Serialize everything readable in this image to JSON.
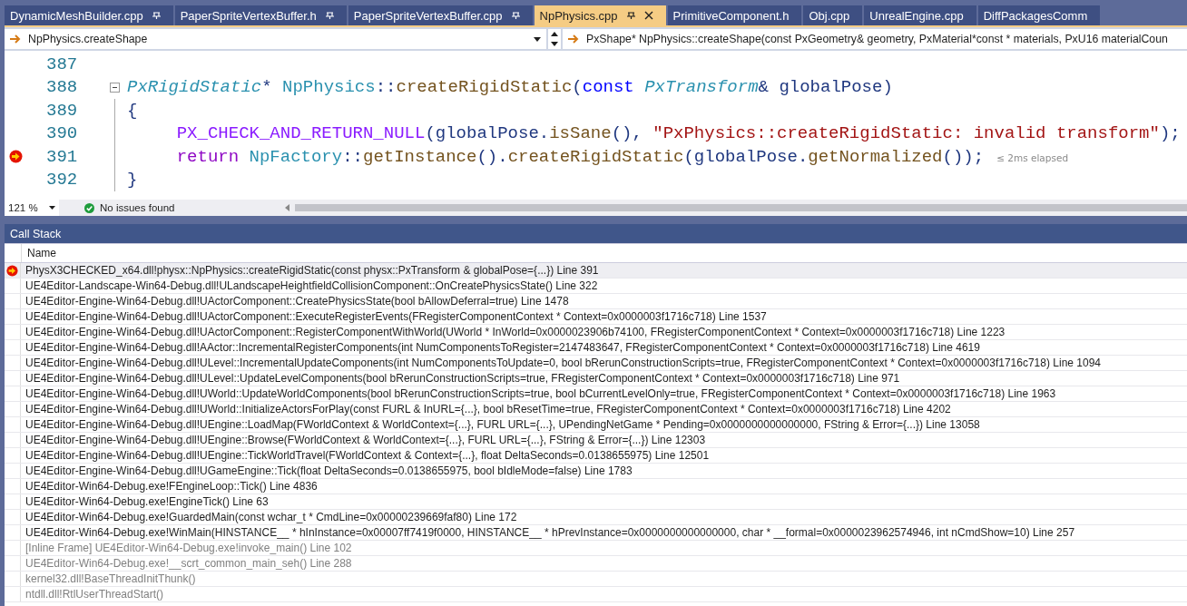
{
  "tabs": [
    {
      "label": "DynamicMeshBuilder.cpp",
      "selected": false,
      "pinned": true
    },
    {
      "label": "PaperSpriteVertexBuffer.h",
      "selected": false,
      "pinned": true
    },
    {
      "label": "PaperSpriteVertexBuffer.cpp",
      "selected": false,
      "pinned": true
    },
    {
      "label": "NpPhysics.cpp",
      "selected": true,
      "pinned": true
    },
    {
      "label": "PrimitiveComponent.h",
      "selected": false,
      "pinned": false
    },
    {
      "label": "Obj.cpp",
      "selected": false,
      "pinned": false
    },
    {
      "label": "UnrealEngine.cpp",
      "selected": false,
      "pinned": false
    },
    {
      "label": "DiffPackagesComm",
      "selected": false,
      "pinned": false
    }
  ],
  "navigation": {
    "scope": "NpPhysics.createShape",
    "member": "PxShape* NpPhysics::createShape(const PxGeometry& geometry, PxMaterial*const * materials, PxU16 materialCoun"
  },
  "editor": {
    "lines": [
      {
        "number": "387",
        "foldable": false,
        "breakpoint": false
      },
      {
        "number": "388",
        "foldable": true,
        "breakpoint": false,
        "indented": false,
        "tokens": [
          {
            "kind": "type",
            "text": "PxRigidStatic"
          },
          {
            "kind": "plain",
            "text": "* "
          },
          {
            "kind": "class",
            "text": "NpPhysics"
          },
          {
            "kind": "plain",
            "text": "::"
          },
          {
            "kind": "func",
            "text": "createRigidStatic"
          },
          {
            "kind": "plain",
            "text": "("
          },
          {
            "kind": "keyword",
            "text": "const "
          },
          {
            "kind": "type",
            "text": "PxTransform"
          },
          {
            "kind": "plain",
            "text": "& globalPose)"
          }
        ]
      },
      {
        "number": "389",
        "foldable": false,
        "breakpoint": false,
        "indented": false,
        "tokens": [
          {
            "kind": "plain",
            "text": "{"
          }
        ]
      },
      {
        "number": "390",
        "foldable": false,
        "breakpoint": false,
        "indented": true,
        "tokens": [
          {
            "kind": "macro",
            "text": "PX_CHECK_AND_RETURN_NULL"
          },
          {
            "kind": "plain",
            "text": "(globalPose."
          },
          {
            "kind": "func",
            "text": "isSane"
          },
          {
            "kind": "plain",
            "text": "(), "
          },
          {
            "kind": "string",
            "text": "\"PxPhysics::createRigidStatic: invalid transform\""
          },
          {
            "kind": "plain",
            "text": ");"
          }
        ]
      },
      {
        "number": "391",
        "foldable": false,
        "breakpoint": true,
        "indented": true,
        "tokens": [
          {
            "kind": "control",
            "text": "return "
          },
          {
            "kind": "class",
            "text": "NpFactory"
          },
          {
            "kind": "plain",
            "text": "::"
          },
          {
            "kind": "func",
            "text": "getInstance"
          },
          {
            "kind": "plain",
            "text": "()."
          },
          {
            "kind": "func",
            "text": "createRigidStatic"
          },
          {
            "kind": "plain",
            "text": "(globalPose."
          },
          {
            "kind": "func",
            "text": "getNormalized"
          },
          {
            "kind": "plain",
            "text": "());"
          },
          {
            "kind": "hint",
            "text": "≤ 2ms elapsed"
          }
        ]
      },
      {
        "number": "392",
        "foldable": false,
        "breakpoint": false,
        "indented": false,
        "tokens": [
          {
            "kind": "plain",
            "text": "}"
          }
        ]
      }
    ]
  },
  "status": {
    "zoom": "121 %",
    "issues": "No issues found"
  },
  "call_stack": {
    "title": "Call Stack",
    "column": "Name",
    "frames": [
      {
        "kind": "current",
        "text": "PhysX3CHECKED_x64.dll!physx::NpPhysics::createRigidStatic(const physx::PxTransform & globalPose={...}) Line 391"
      },
      {
        "kind": "normal",
        "text": "UE4Editor-Landscape-Win64-Debug.dll!ULandscapeHeightfieldCollisionComponent::OnCreatePhysicsState() Line 322"
      },
      {
        "kind": "normal",
        "text": "UE4Editor-Engine-Win64-Debug.dll!UActorComponent::CreatePhysicsState(bool bAllowDeferral=true) Line 1478"
      },
      {
        "kind": "normal",
        "text": "UE4Editor-Engine-Win64-Debug.dll!UActorComponent::ExecuteRegisterEvents(FRegisterComponentContext * Context=0x0000003f1716c718) Line 1537"
      },
      {
        "kind": "normal",
        "text": "UE4Editor-Engine-Win64-Debug.dll!UActorComponent::RegisterComponentWithWorld(UWorld * InWorld=0x0000023906b74100, FRegisterComponentContext * Context=0x0000003f1716c718) Line 1223"
      },
      {
        "kind": "normal",
        "text": "UE4Editor-Engine-Win64-Debug.dll!AActor::IncrementalRegisterComponents(int NumComponentsToRegister=2147483647, FRegisterComponentContext * Context=0x0000003f1716c718) Line 4619"
      },
      {
        "kind": "normal",
        "text": "UE4Editor-Engine-Win64-Debug.dll!ULevel::IncrementalUpdateComponents(int NumComponentsToUpdate=0, bool bRerunConstructionScripts=true, FRegisterComponentContext * Context=0x0000003f1716c718) Line 1094"
      },
      {
        "kind": "normal",
        "text": "UE4Editor-Engine-Win64-Debug.dll!ULevel::UpdateLevelComponents(bool bRerunConstructionScripts=true, FRegisterComponentContext * Context=0x0000003f1716c718) Line 971"
      },
      {
        "kind": "normal",
        "text": "UE4Editor-Engine-Win64-Debug.dll!UWorld::UpdateWorldComponents(bool bRerunConstructionScripts=true, bool bCurrentLevelOnly=true, FRegisterComponentContext * Context=0x0000003f1716c718) Line 1963"
      },
      {
        "kind": "normal",
        "text": "UE4Editor-Engine-Win64-Debug.dll!UWorld::InitializeActorsForPlay(const FURL & InURL={...}, bool bResetTime=true, FRegisterComponentContext * Context=0x0000003f1716c718) Line 4202"
      },
      {
        "kind": "normal",
        "text": "UE4Editor-Engine-Win64-Debug.dll!UEngine::LoadMap(FWorldContext & WorldContext={...}, FURL URL={...}, UPendingNetGame * Pending=0x0000000000000000, FString & Error={...}) Line 13058"
      },
      {
        "kind": "normal",
        "text": "UE4Editor-Engine-Win64-Debug.dll!UEngine::Browse(FWorldContext & WorldContext={...}, FURL URL={...}, FString & Error={...}) Line 12303"
      },
      {
        "kind": "normal",
        "text": "UE4Editor-Engine-Win64-Debug.dll!UEngine::TickWorldTravel(FWorldContext & Context={...}, float DeltaSeconds=0.0138655975) Line 12501"
      },
      {
        "kind": "normal",
        "text": "UE4Editor-Engine-Win64-Debug.dll!UGameEngine::Tick(float DeltaSeconds=0.0138655975, bool bIdleMode=false) Line 1783"
      },
      {
        "kind": "normal",
        "text": "UE4Editor-Win64-Debug.exe!FEngineLoop::Tick() Line 4836"
      },
      {
        "kind": "normal",
        "text": "UE4Editor-Win64-Debug.exe!EngineTick() Line 63"
      },
      {
        "kind": "normal",
        "text": "UE4Editor-Win64-Debug.exe!GuardedMain(const wchar_t * CmdLine=0x00000239669faf80) Line 172"
      },
      {
        "kind": "normal",
        "text": "UE4Editor-Win64-Debug.exe!WinMain(HINSTANCE__ * hInInstance=0x00007ff7419f0000, HINSTANCE__ * hPrevInstance=0x0000000000000000, char * __formal=0x0000023962574946, int nCmdShow=10) Line 257"
      },
      {
        "kind": "external",
        "text": "[Inline Frame] UE4Editor-Win64-Debug.exe!invoke_main() Line 102"
      },
      {
        "kind": "external",
        "text": "UE4Editor-Win64-Debug.exe!__scrt_common_main_seh() Line 288"
      },
      {
        "kind": "external",
        "text": "kernel32.dll!BaseThreadInitThunk()"
      },
      {
        "kind": "external",
        "text": "ntdll.dll!RtlUserThreadStart()"
      }
    ]
  }
}
